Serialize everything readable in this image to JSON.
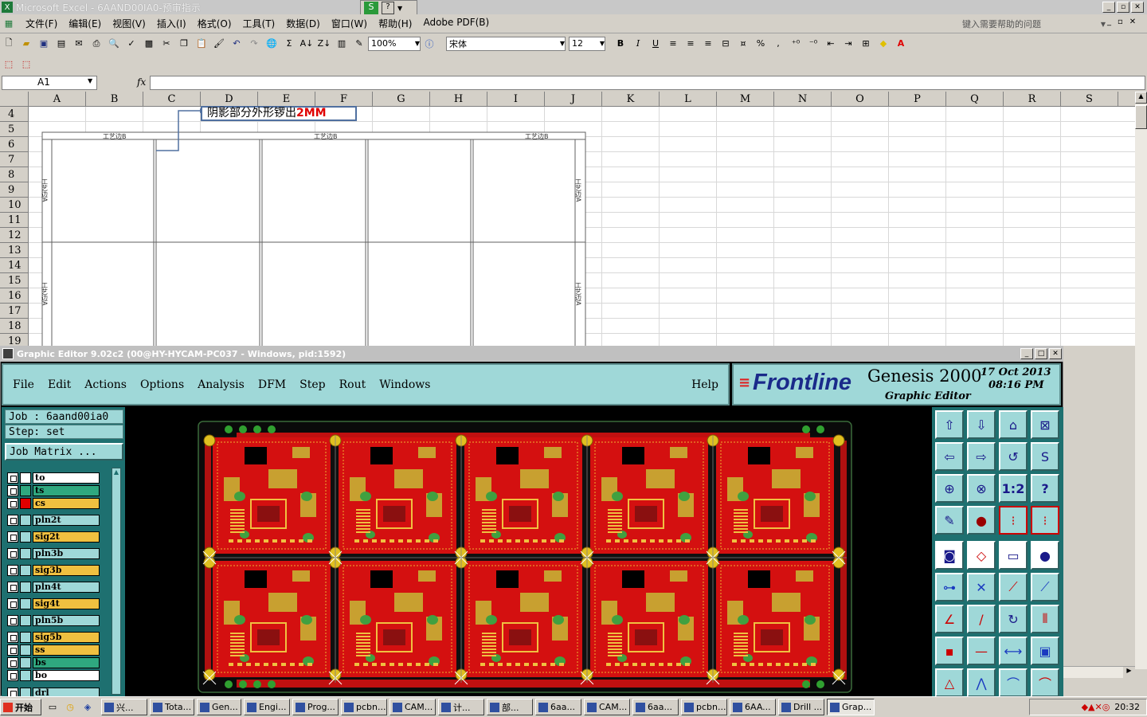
{
  "excel": {
    "title": "Microsoft Excel - 6AAND00IA0-预审指示",
    "menu": [
      "文件(F)",
      "编辑(E)",
      "视图(V)",
      "插入(I)",
      "格式(O)",
      "工具(T)",
      "数据(D)",
      "窗口(W)",
      "帮助(H)",
      "Adobe PDF(B)"
    ],
    "help_placeholder": "键入需要帮助的问题",
    "zoom": "100%",
    "font_name": "宋体",
    "font_size": "12",
    "bold": "B",
    "italic": "I",
    "underline": "U",
    "percent": "%",
    "comma": ",",
    "sigma": "Σ",
    "name_box": "A1",
    "fx": "fx",
    "columns": [
      "A",
      "B",
      "C",
      "D",
      "E",
      "F",
      "G",
      "H",
      "I",
      "J",
      "K",
      "L",
      "M",
      "N",
      "O",
      "P",
      "Q",
      "R",
      "S"
    ],
    "rows": [
      "4",
      "5",
      "6",
      "7",
      "8",
      "9",
      "10",
      "11",
      "12",
      "13",
      "14",
      "15",
      "16",
      "17",
      "18",
      "19"
    ],
    "callout_text": "阴影部分外形锣出",
    "callout_red": "2MM",
    "edge_label_top": "工艺边B",
    "edge_label_side": "工艺边A"
  },
  "genesis": {
    "title": "Graphic Editor 9.02c2 (00@HY-HYCAM-PC037 - Windows, pid:1592)",
    "menu": [
      "File",
      "Edit",
      "Actions",
      "Options",
      "Analysis",
      "DFM",
      "Step",
      "Rout",
      "Windows"
    ],
    "help": "Help",
    "logo": "Frontline",
    "product": "Genesis 2000",
    "subtitle": "Graphic Editor",
    "date": "17 Oct 2013",
    "time": "08:16 PM",
    "job": "Job  : 6aand00ia0",
    "step": "Step: set",
    "job_matrix": "Job Matrix ...",
    "layers": [
      {
        "name": "to",
        "color": "#ffffff",
        "sw": "#ffffff"
      },
      {
        "name": "ts",
        "color": "#2fa87f",
        "sw": "#2fa87f"
      },
      {
        "name": "cs",
        "color": "#f0c040",
        "sw": "#e00000"
      },
      {
        "name": "pln2t",
        "color": "#9fd8d8",
        "sw": "#9fd8d8"
      },
      {
        "name": "sig2t",
        "color": "#f0c040",
        "sw": "#9fd8d8"
      },
      {
        "name": "pln3b",
        "color": "#9fd8d8",
        "sw": "#9fd8d8"
      },
      {
        "name": "sig3b",
        "color": "#f0c040",
        "sw": "#9fd8d8"
      },
      {
        "name": "pln4t",
        "color": "#9fd8d8",
        "sw": "#9fd8d8"
      },
      {
        "name": "sig4t",
        "color": "#f0c040",
        "sw": "#9fd8d8"
      },
      {
        "name": "pln5b",
        "color": "#9fd8d8",
        "sw": "#9fd8d8"
      },
      {
        "name": "sig5b",
        "color": "#f0c040",
        "sw": "#9fd8d8"
      },
      {
        "name": "ss",
        "color": "#f0c040",
        "sw": "#9fd8d8"
      },
      {
        "name": "bs",
        "color": "#2fa87f",
        "sw": "#9fd8d8"
      },
      {
        "name": "bo",
        "color": "#ffffff",
        "sw": "#9fd8d8"
      },
      {
        "name": "drl",
        "color": "#9fd8d8",
        "sw": "#9fd8d8"
      }
    ],
    "ratio_btn": "1:2",
    "question_btn": "?"
  },
  "taskbar": {
    "start": "开始",
    "tasks": [
      "兴...",
      "Tota...",
      "Gen...",
      "Engi...",
      "Prog...",
      "pcbn...",
      "CAM...",
      "计...",
      "部...",
      "6aa...",
      "CAM...",
      "6aa...",
      "pcbn...",
      "6AA...",
      "Drill ...",
      "Grap..."
    ],
    "clock": "20:32"
  }
}
